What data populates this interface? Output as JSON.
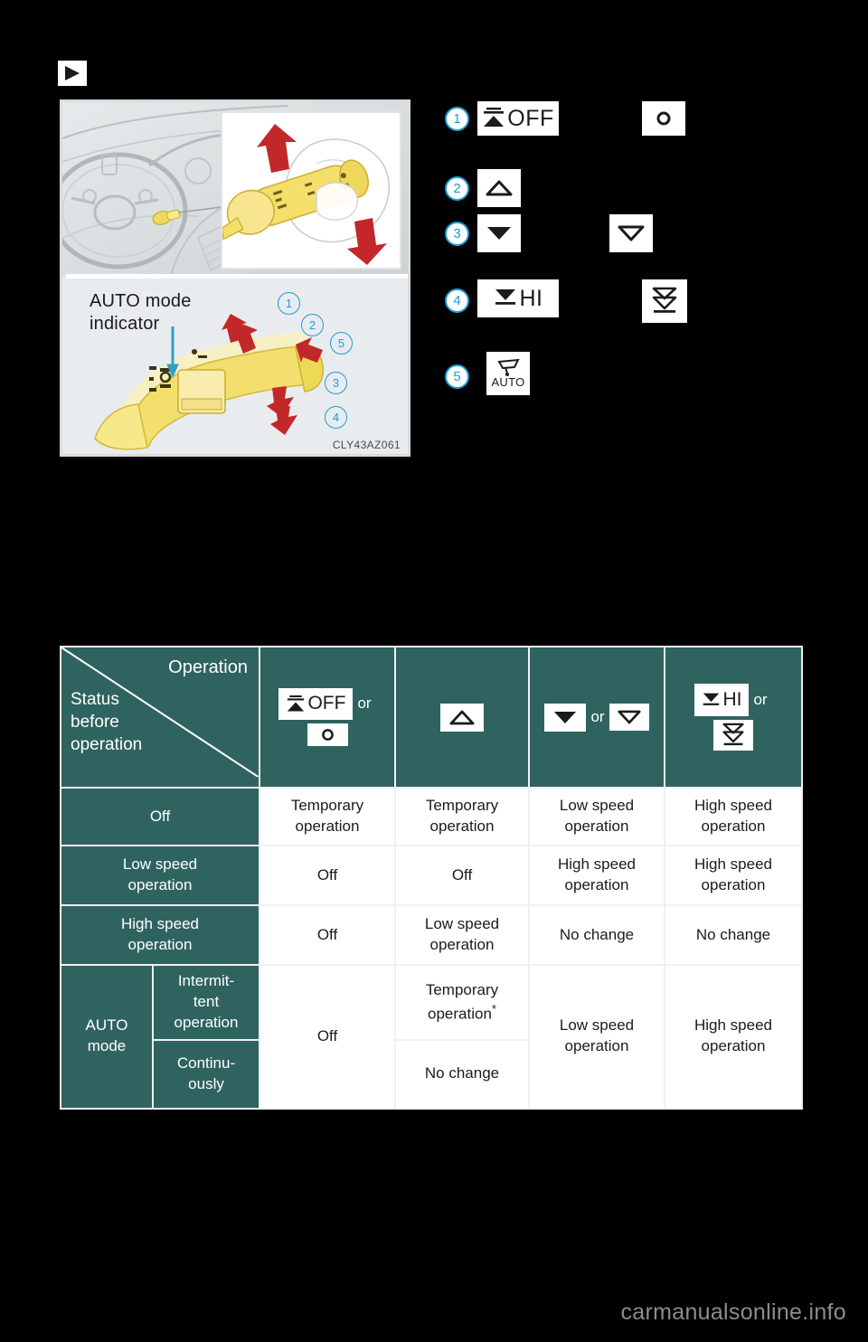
{
  "page": {
    "marker_icon": "solid-right-triangle",
    "watermark": "carmanualsonline.info"
  },
  "illustration": {
    "label": "AUTO mode",
    "label_line2": "indicator",
    "figure_code": "CLY43AZ061",
    "callouts": [
      "1",
      "2",
      "5",
      "3",
      "4"
    ]
  },
  "legend": {
    "items": [
      {
        "number": "1",
        "icon": "mist-off-icon",
        "icon_text": "OFF",
        "alt_icon": "circle-o-icon",
        "alt_icon_text": "O"
      },
      {
        "number": "2",
        "icon": "triangle-up-outline-icon",
        "icon_text": ""
      },
      {
        "number": "3",
        "icon": "triangle-down-solid-icon",
        "icon_text": "",
        "alt_icon": "triangle-down-outline-icon"
      },
      {
        "number": "4",
        "icon": "hi-speed-icon",
        "icon_text": "HI",
        "alt_icon": "double-chevron-down-icon"
      },
      {
        "number": "5",
        "icon": "wiper-auto-icon",
        "icon_text": "AUTO"
      }
    ]
  },
  "table": {
    "corner": {
      "operation_label": "Operation",
      "status_label_lines": [
        "Status",
        "before",
        "operation"
      ]
    },
    "or_label": "or",
    "columns": [
      {
        "icon": "mist-off-icon",
        "icon_text": "OFF",
        "alt_icon": "circle-o-icon",
        "alt_icon_text": "O",
        "or": true
      },
      {
        "icon": "triangle-up-outline-icon",
        "icon_text": "",
        "or": false
      },
      {
        "icon": "triangle-down-solid-icon",
        "icon_text": "",
        "alt_icon": "triangle-down-outline-icon",
        "or": true
      },
      {
        "icon": "hi-speed-icon",
        "icon_text": "HI",
        "alt_icon": "double-chevron-down-icon",
        "or": true
      }
    ],
    "rows": [
      {
        "label": "Off",
        "cells": [
          "Temporary\noperation",
          "Temporary\noperation",
          "Low speed\noperation",
          "High speed\noperation"
        ]
      },
      {
        "label": "Low speed\noperation",
        "cells": [
          "Off",
          "Off",
          "High speed\noperation",
          "High speed\noperation"
        ]
      },
      {
        "label": "High speed\noperation",
        "cells": [
          "Off",
          "Low speed\noperation",
          "No change",
          "No change"
        ]
      }
    ],
    "auto_group": {
      "label": "AUTO\nmode",
      "sub_rows": [
        {
          "label": "Intermit-\ntent\noperation",
          "col2": "Temporary\noperation",
          "col2_star": "*"
        },
        {
          "label": "Continu-\nously",
          "col2": "No change"
        }
      ],
      "col1": "Off",
      "col3": "Low speed\noperation",
      "col4": "High speed\noperation"
    }
  },
  "colors": {
    "header_teal": "#2f6360",
    "callout_blue": "#1f9bd7",
    "arrow_red": "#c2282a",
    "lever_yellow": "#f2dd6e"
  }
}
